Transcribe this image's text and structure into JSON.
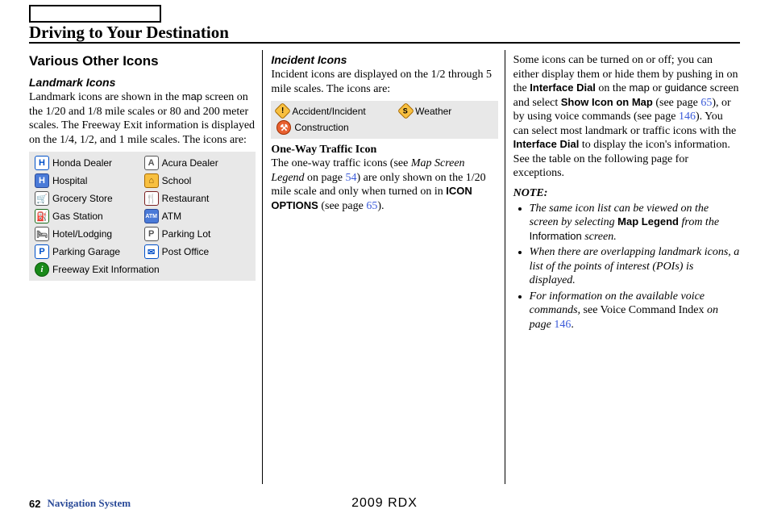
{
  "page_title": "Driving to Your Destination",
  "col1": {
    "section_title": "Various Other Icons",
    "landmark_heading": "Landmark Icons",
    "landmark_body_1": "Landmark icons are shown in the ",
    "landmark_body_map": "map",
    "landmark_body_2": " screen on the 1/20 and 1/8 mile scales or 80 and 200 meter scales. The Freeway Exit information is displayed on the 1/4, 1/2, and 1 mile scales. The icons are:",
    "icons": [
      {
        "name": "honda-dealer-icon",
        "glyph": "H",
        "cls": "ic-honda",
        "label": "Honda Dealer"
      },
      {
        "name": "acura-dealer-icon",
        "glyph": "A",
        "cls": "ic-acura",
        "label": "Acura Dealer"
      },
      {
        "name": "hospital-icon",
        "glyph": "H",
        "cls": "ic-hospital",
        "label": "Hospital"
      },
      {
        "name": "school-icon",
        "glyph": "⌂",
        "cls": "ic-school",
        "label": "School"
      },
      {
        "name": "grocery-icon",
        "glyph": "🛒",
        "cls": "ic-grocery",
        "label": "Grocery Store"
      },
      {
        "name": "restaurant-icon",
        "glyph": "🍴",
        "cls": "ic-restaurant",
        "label": "Restaurant"
      },
      {
        "name": "gas-icon",
        "glyph": "⛽",
        "cls": "ic-gas",
        "label": "Gas Station"
      },
      {
        "name": "atm-icon",
        "glyph": "ATM",
        "cls": "ic-atm",
        "label": "ATM"
      },
      {
        "name": "hotel-icon",
        "glyph": "🛏",
        "cls": "ic-hotel",
        "label": "Hotel/Lodging"
      },
      {
        "name": "parking-lot-icon",
        "glyph": "P",
        "cls": "ic-parking",
        "label": "Parking Lot"
      },
      {
        "name": "parking-garage-icon",
        "glyph": "P",
        "cls": "ic-garage",
        "label": "Parking Garage"
      },
      {
        "name": "post-office-icon",
        "glyph": "✉",
        "cls": "ic-post",
        "label": "Post Office"
      },
      {
        "name": "freeway-exit-icon",
        "glyph": "i",
        "cls": "ic-info",
        "label": "Freeway Exit Information",
        "full": true
      }
    ]
  },
  "col2": {
    "incident_heading": "Incident Icons",
    "incident_body": "Incident icons are displayed on the 1/2 through 5 mile scales. The icons are:",
    "icons": [
      {
        "name": "accident-icon",
        "glyph": "!",
        "cls": "ic-accident",
        "label": "Accident/Incident"
      },
      {
        "name": "weather-icon",
        "glyph": "S",
        "cls": "ic-weather",
        "label": "Weather"
      },
      {
        "name": "construction-icon",
        "glyph": "⚒",
        "cls": "ic-construction",
        "label": "Construction"
      }
    ],
    "oneway_heading": "One-Way Traffic Icon",
    "oneway_1": "The one-way traffic icons (see ",
    "oneway_italic": "Map Screen Legend",
    "oneway_2": " on page ",
    "oneway_pg1": "54",
    "oneway_3": ") are only shown on the 1/20 mile scale and only when turned on in ",
    "oneway_bold": "ICON OPTIONS",
    "oneway_4": " (see page ",
    "oneway_pg2": "65",
    "oneway_5": ")."
  },
  "col3": {
    "p1_a": "Some icons can be turned on or off; you can either display them or hide them by pushing in on the ",
    "p1_b": "Interface Dial",
    "p1_c": " on the ",
    "p1_map": "map",
    "p1_d": " or ",
    "p1_guidance": "guidance",
    "p1_e": " screen and select ",
    "p1_f": "Show Icon on Map",
    "p1_g": " (see page ",
    "p1_pg1": "65",
    "p1_h": "), or by using voice commands (see page ",
    "p1_pg2": "146",
    "p1_i": "). You can select most landmark or traffic icons with the ",
    "p1_j": "Interface Dial",
    "p1_k": " to display the icon's information. See the table on the following page for exceptions.",
    "note_label": "NOTE:",
    "n1_a": "The same icon list can be viewed on the screen by selecting ",
    "n1_b": "Map Legend",
    "n1_c": " from the ",
    "n1_info": "Information",
    "n1_d": " screen.",
    "n2": "When there are overlapping landmark icons, a list of the points of interest (POIs) is displayed.",
    "n3_a": "For information on the available voice commands, ",
    "n3_b": "see Voice Command Index",
    "n3_c": " on page ",
    "n3_pg": "146",
    "n3_d": "."
  },
  "footer": {
    "page": "62",
    "label": "Navigation System",
    "vehicle": "2009 RDX"
  }
}
